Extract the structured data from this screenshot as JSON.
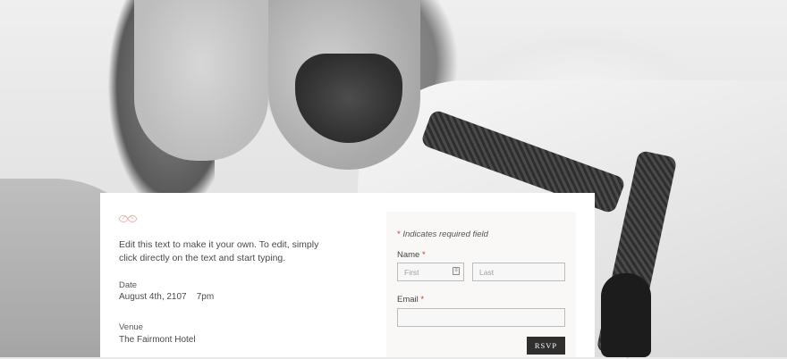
{
  "intro_text": "Edit this text to make it your own. To edit, simply click directly on the text and start typing.",
  "date": {
    "label": "Date",
    "value": "August 4th, 2107    7pm"
  },
  "venue": {
    "label": "Venue",
    "value": "The Fairmont Hotel"
  },
  "form": {
    "required_note": "Indicates required field",
    "required_star": "*",
    "name_label": "Name",
    "first_placeholder": "First",
    "last_placeholder": "Last",
    "email_label": "Email",
    "email_placeholder": "",
    "submit_label": "RSVP"
  },
  "colors": {
    "accent_star": "#c0392b",
    "button_bg": "#2f2f2f",
    "ornament": "#e8b4ad"
  }
}
